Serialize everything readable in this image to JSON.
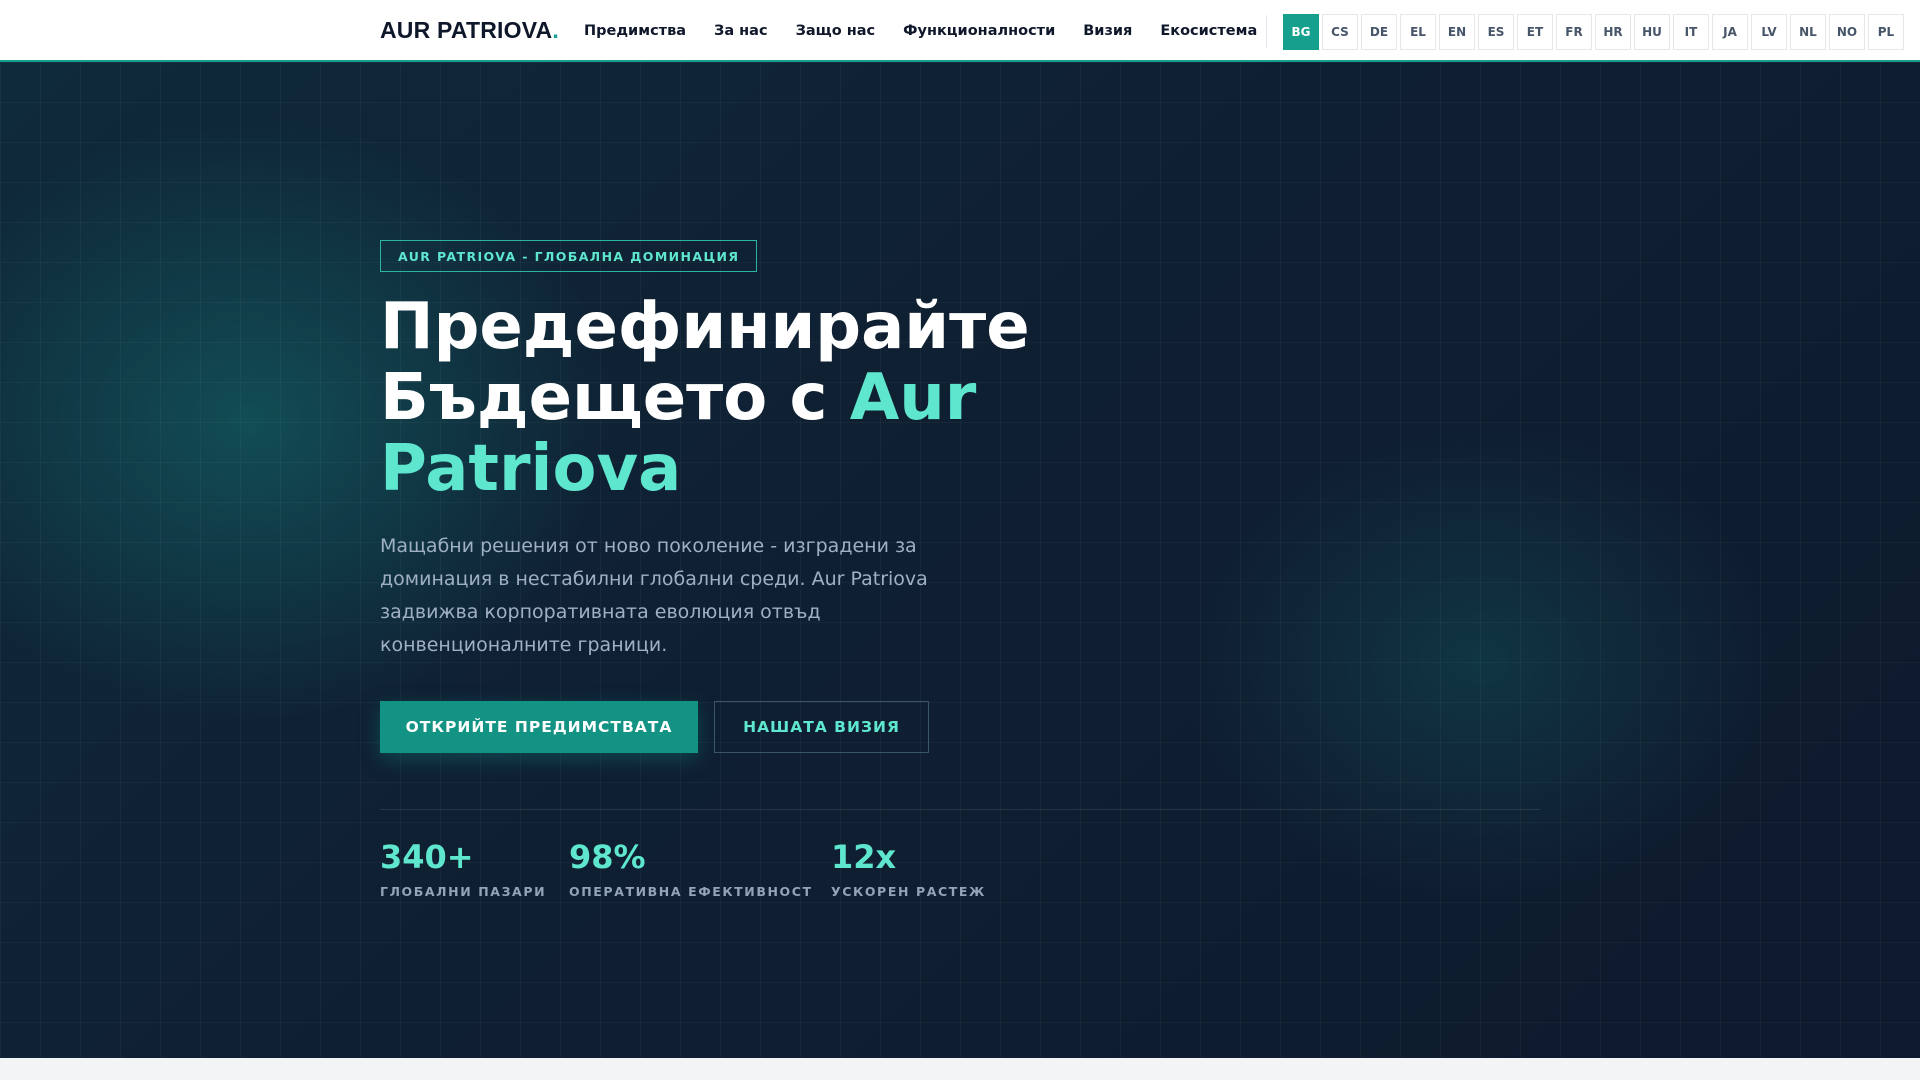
{
  "header": {
    "logo_text": "AUR PATRIOVA",
    "logo_dot": ".",
    "nav": [
      "Предимства",
      "За нас",
      "Защо нас",
      "Функционалности",
      "Визия",
      "Екосистема"
    ],
    "languages": [
      "BG",
      "CS",
      "DE",
      "EL",
      "EN",
      "ES",
      "ET",
      "FR",
      "HR",
      "HU",
      "IT",
      "JA",
      "LV",
      "NL",
      "NO",
      "PL"
    ],
    "active_language": "BG"
  },
  "hero": {
    "badge": "AUR PATRIOVA - ГЛОБАЛНА ДОМИНАЦИЯ",
    "title_line1": "Предефинирайте",
    "title_line2": "Бъдещето с ",
    "title_accent": "Aur Patriova",
    "description": "Мащабни решения от ново поколение - изградени за доминация в нестабилни глобални среди. Aur Patriova задвижва корпоративната еволюция отвъд конвенционалните граници.",
    "primary_button": "ОТКРИЙТЕ ПРЕДИМСТВАТА",
    "secondary_button": "НАШАТА ВИЗИЯ",
    "stats": [
      {
        "value": "340+",
        "label": "ГЛОБАЛНИ ПАЗАРИ"
      },
      {
        "value": "98%",
        "label": "ОПЕРАТИВНА ЕФЕКТИВНОСТ"
      },
      {
        "value": "12x",
        "label": "УСКОРЕН РАСТЕЖ"
      }
    ]
  },
  "colors": {
    "accent": "#5ee6cf",
    "brand": "#14a08c",
    "hero_background": "#0f1f32"
  }
}
